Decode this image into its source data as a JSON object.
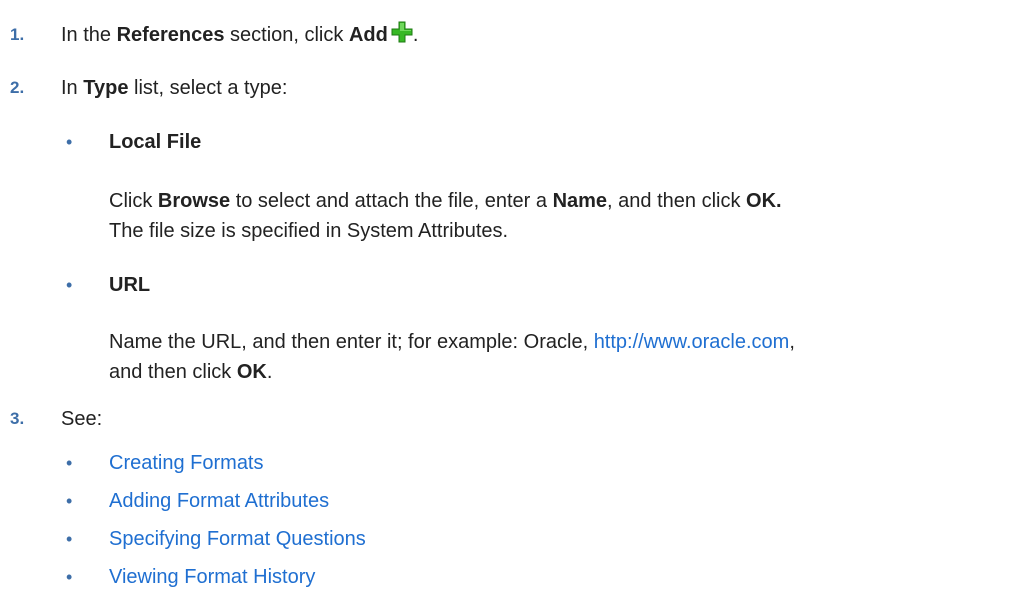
{
  "steps": [
    {
      "number": "1.",
      "pre": "In the ",
      "bold1": "References",
      "mid": " section, click ",
      "bold2": "Add",
      "post": ".",
      "icon": "green-plus-add-icon"
    },
    {
      "number": "2.",
      "pre": "In ",
      "bold1": "Type",
      "post": " list, select a type:"
    },
    {
      "number": "3.",
      "text": "See:"
    }
  ],
  "types": [
    {
      "title": "Local File",
      "desc": {
        "t1": "Click ",
        "b1": "Browse",
        "t2": " to select and attach the file, enter a ",
        "b2": "Name",
        "t3": ", and then click ",
        "b3": "OK.",
        "t4": "The file size is specified in System Attributes."
      }
    },
    {
      "title": "URL",
      "desc": {
        "t1": "Name the URL, and then enter it; for example: Oracle, ",
        "link": "http://www.oracle.com",
        "t2": ",",
        "t3": "and then click ",
        "b1": "OK",
        "t4": "."
      }
    }
  ],
  "see_links": [
    "Creating Formats",
    "Adding Format Attributes",
    "Specifying Format Questions",
    "Viewing Format History"
  ],
  "bullet_char": "•",
  "colors": {
    "text": "#222222",
    "step_number": "#3d6ea8",
    "link": "#1f6fd1",
    "icon_green": "#37b825"
  }
}
